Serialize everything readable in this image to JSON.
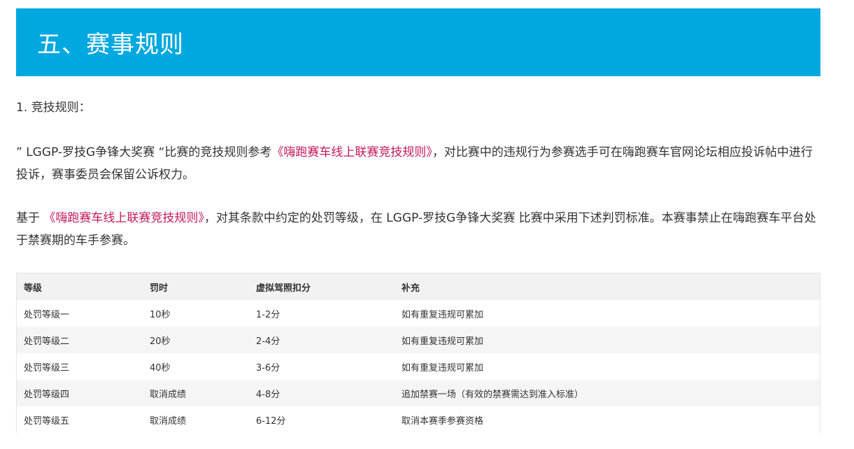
{
  "section": {
    "title": "五、赛事规则"
  },
  "rules": {
    "heading": "1. 竞技规则：",
    "para1": {
      "before": "” LGGP-罗技G争锋大奖赛 “比赛的竞技规则参考",
      "link": "《嗨跑赛车线上联赛竞技规则》",
      "after": "，对比赛中的违规行为参赛选手可在嗨跑赛车官网论坛相应投诉帖中进行投诉，赛事委员会保留公诉权力。"
    },
    "para2": {
      "before": "基于",
      "link": "《嗨跑赛车线上联赛竞技规则》",
      "after": "，对其条款中约定的处罚等级，在 LGGP-罗技G争锋大奖赛 比赛中采用下述判罚标准。本赛事禁止在嗨跑赛车平台处于禁赛期的车手参赛。"
    }
  },
  "table": {
    "headers": [
      "等级",
      "罚时",
      "虚拟驾照扣分",
      "补充"
    ],
    "rows": [
      [
        "处罚等级一",
        "10秒",
        "1-2分",
        "如有重复违规可累加"
      ],
      [
        "处罚等级二",
        "20秒",
        "2-4分",
        "如有重复违规可累加"
      ],
      [
        "处罚等级三",
        "40秒",
        "3-6分",
        "如有重复违规可累加"
      ],
      [
        "处罚等级四",
        "取消成绩",
        "4-8分",
        "追加禁赛一场（有效的禁赛需达到准入标准）"
      ],
      [
        "处罚等级五",
        "取消成绩",
        "6-12分",
        "取消本赛季参赛资格"
      ]
    ]
  },
  "colors": {
    "header_bg": "#00a8e0",
    "link": "#c2185b"
  }
}
